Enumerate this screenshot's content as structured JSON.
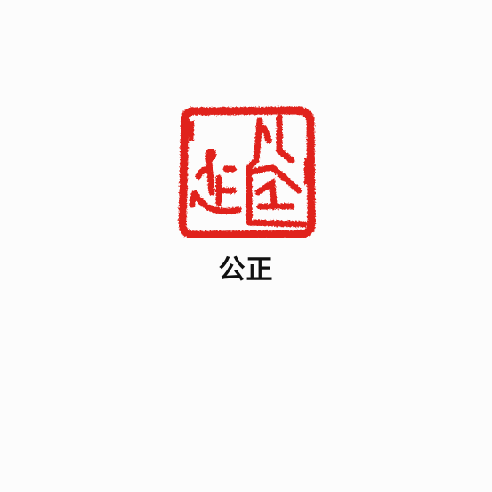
{
  "seal": {
    "image": "red-square-seal-stamp",
    "text": "公正",
    "color": "#e0241b"
  },
  "caption": {
    "text": "公正"
  }
}
